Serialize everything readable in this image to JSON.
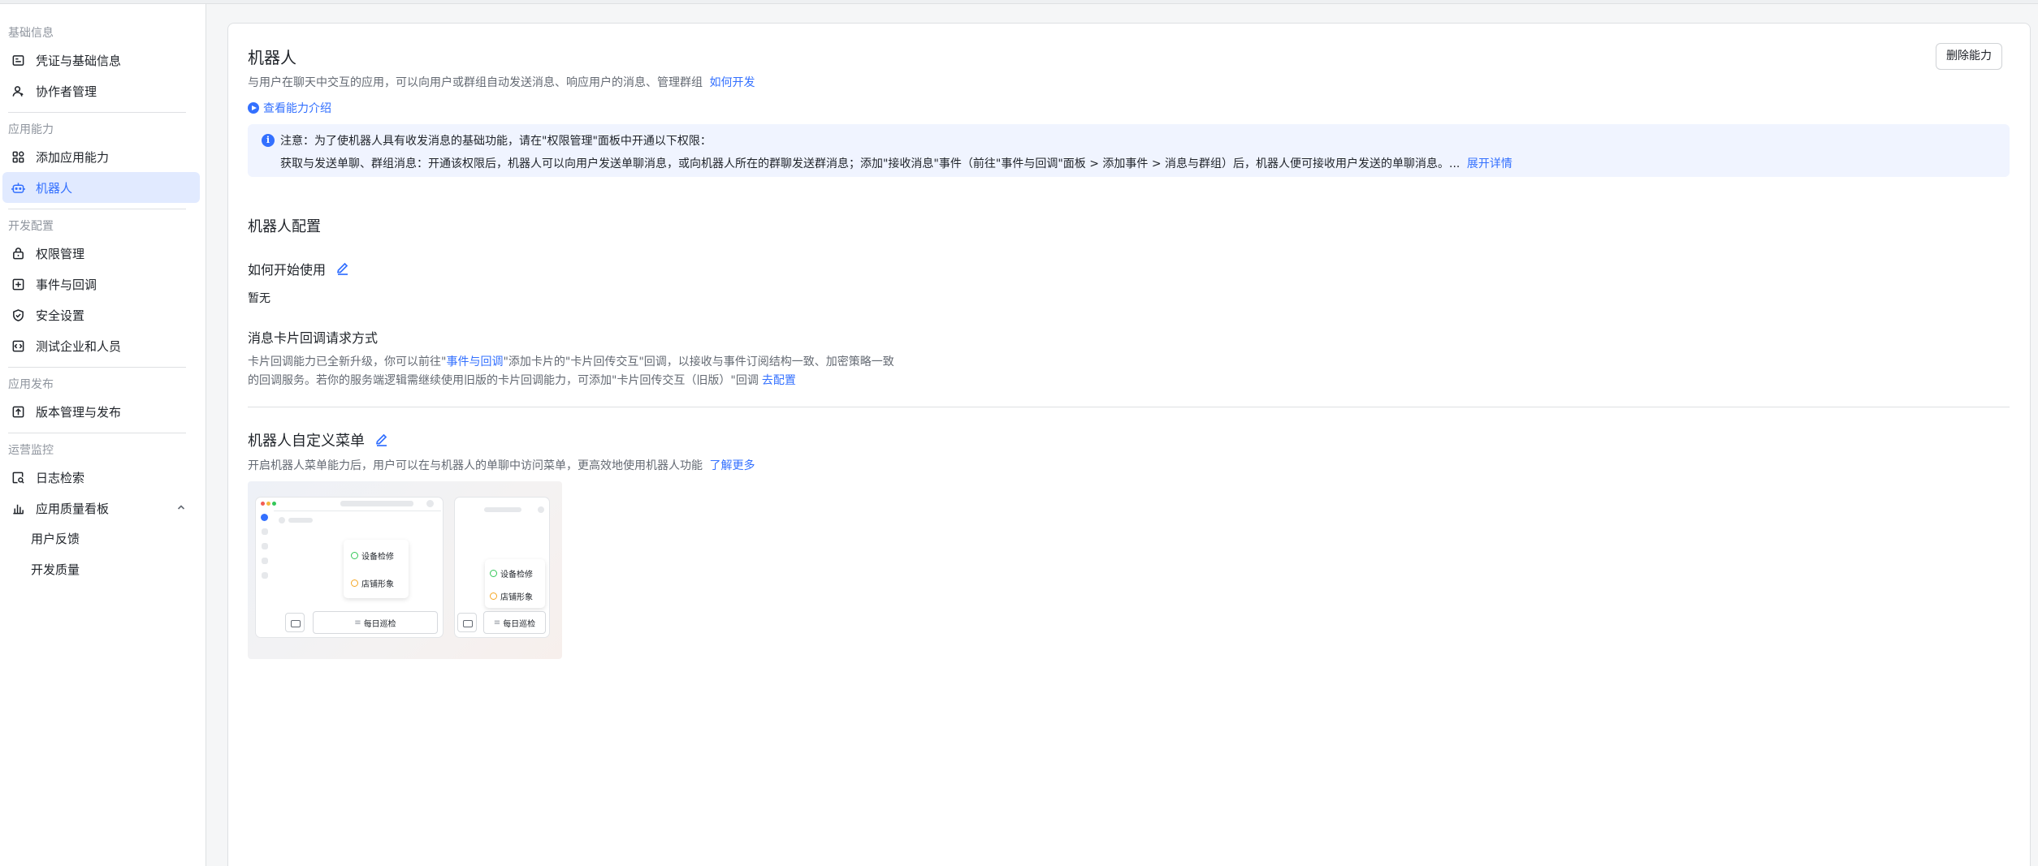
{
  "sidebar": {
    "groups": [
      {
        "title": "基础信息",
        "items": [
          {
            "label": "凭证与基础信息",
            "icon": "credential-icon"
          },
          {
            "label": "协作者管理",
            "icon": "user-manage-icon"
          }
        ]
      },
      {
        "title": "应用能力",
        "items": [
          {
            "label": "添加应用能力",
            "icon": "add-capability-icon"
          },
          {
            "label": "机器人",
            "icon": "robot-icon",
            "active": true
          }
        ]
      },
      {
        "title": "开发配置",
        "items": [
          {
            "label": "权限管理",
            "icon": "permission-icon"
          },
          {
            "label": "事件与回调",
            "icon": "event-callback-icon"
          },
          {
            "label": "安全设置",
            "icon": "shield-icon"
          },
          {
            "label": "测试企业和人员",
            "icon": "test-icon"
          }
        ]
      },
      {
        "title": "应用发布",
        "items": [
          {
            "label": "版本管理与发布",
            "icon": "upload-icon"
          }
        ]
      },
      {
        "title": "运营监控",
        "items": [
          {
            "label": "日志检索",
            "icon": "log-search-icon"
          },
          {
            "label": "应用质量看板",
            "icon": "bar-chart-icon",
            "expanded": true,
            "children": [
              "用户反馈",
              "开发质量"
            ]
          }
        ]
      }
    ]
  },
  "main": {
    "title": "机器人",
    "description": "与用户在聊天中交互的应用，可以向用户或群组自动发送消息、响应用户的消息、管理群组",
    "how_to_develop": "如何开发",
    "delete_button": "删除能力",
    "intro_link": "查看能力介绍",
    "notice": {
      "line1": "注意：为了使机器人具有收发消息的基础功能，请在\"权限管理\"面板中开通以下权限：",
      "line2": "获取与发送单聊、群组消息：开通该权限后，机器人可以向用户发送单聊消息，或向机器人所在的群聊发送群消息；添加\"接收消息\"事件（前往\"事件与回调\"面板 > 添加事件 > 消息与群组）后，机器人便可接收用户发送的单聊消息。...",
      "expand": "展开详情"
    },
    "config": {
      "title": "机器人配置",
      "how_to_start": "如何开始使用",
      "how_to_start_value": "暂无",
      "callback_title": "消息卡片回调请求方式",
      "callback_l1_a": "卡片回调能力已全新升级，你可以前往\"",
      "callback_l1_link": "事件与回调",
      "callback_l1_b": "\"添加卡片的\"卡片回传交互\"回调，以接收与事件订阅结构一致、加密策略一致",
      "callback_l2": "的回调服务。若你的服务端逻辑需继续使用旧版的卡片回调能力，可添加\"卡片回传交互（旧版）\"回调",
      "callback_l2_link": "去配置"
    },
    "menu": {
      "title": "机器人自定义菜单",
      "description": "开启机器人菜单能力后，用户可以在与机器人的单聊中访问菜单，更高效地使用机器人功能",
      "learn_more": "了解更多",
      "preview": {
        "item1": "设备检修",
        "item2": "店铺形象",
        "item3": "每日巡检"
      }
    }
  }
}
